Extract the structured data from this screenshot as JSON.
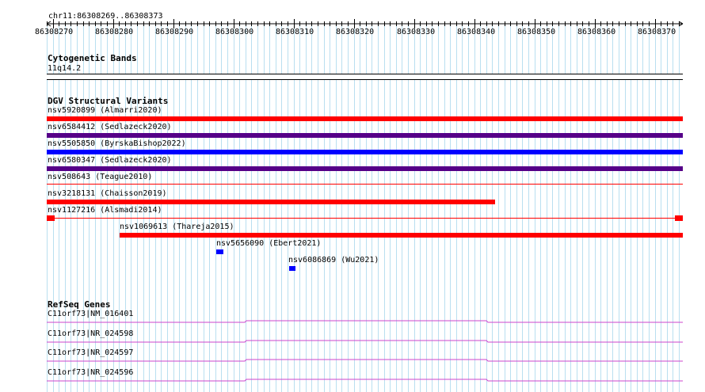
{
  "ruler": {
    "location": "chr11:86308269..86308373",
    "ticks": [
      "86308270",
      "86308280",
      "86308290",
      "86308300",
      "86308310",
      "86308320",
      "86308330",
      "86308340",
      "86308350",
      "86308360",
      "86308370"
    ]
  },
  "cytoband": {
    "title": "Cytogenetic Bands",
    "band": "11q14.2"
  },
  "dgv": {
    "title": "DGV Structural Variants",
    "items": [
      {
        "label": "nsv5920899 (Almarri2020)",
        "color": "#ff0000"
      },
      {
        "label": "nsv6584412 (Sedlazeck2020)",
        "color": "#550088"
      },
      {
        "label": "nsv5505850 (ByrskaBishop2022)",
        "color": "#0000ff"
      },
      {
        "label": "nsv6580347 (Sedlazeck2020)",
        "color": "#550088"
      },
      {
        "label": "nsv508643 (Teague2010)",
        "color": "#ff0000"
      },
      {
        "label": "nsv3218131 (Chaisson2019)",
        "color": "#ff0000"
      },
      {
        "label": "nsv1127216 (Alsmadi2014)",
        "color": "#ff0000"
      },
      {
        "label": "nsv1069613 (Thareja2015)",
        "color": "#ff0000"
      },
      {
        "label": "nsv5656090 (Ebert2021)",
        "color": "#0000ff"
      },
      {
        "label": "nsv6086869 (Wu2021)",
        "color": "#0000ff"
      }
    ]
  },
  "refseq": {
    "title": "RefSeq Genes",
    "color": "#cc44cc",
    "items": [
      {
        "label": "C11orf73|NM_016401"
      },
      {
        "label": "C11orf73|NR_024598"
      },
      {
        "label": "C11orf73|NR_024597"
      },
      {
        "label": "C11orf73|NR_024596"
      }
    ]
  }
}
